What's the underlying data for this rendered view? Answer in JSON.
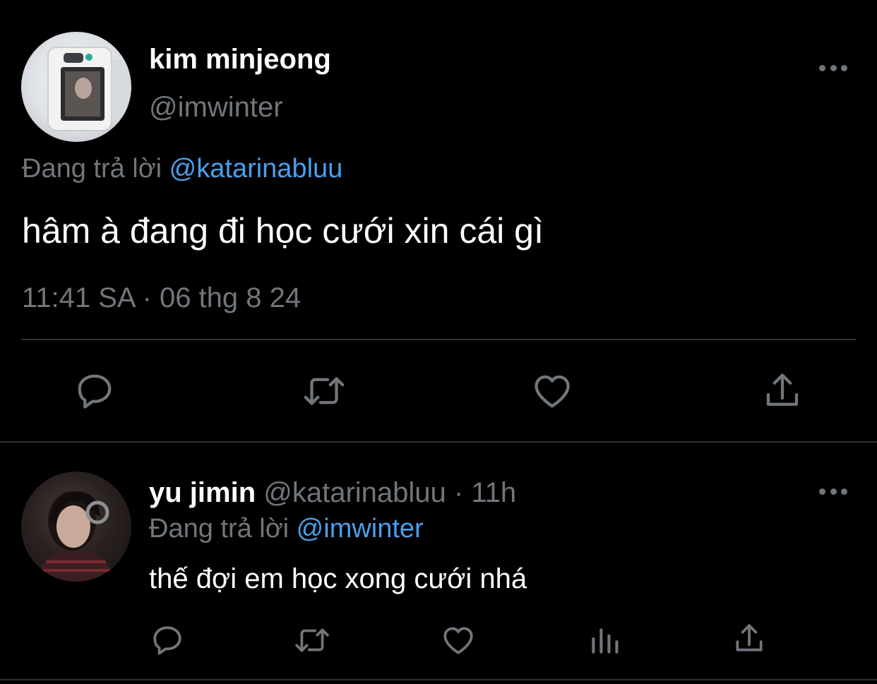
{
  "main_tweet": {
    "display_name": "kim minjeong",
    "handle": "@imwinter",
    "replying_label": "Đang trả lời",
    "replying_to": "@katarinabluu",
    "text": "hâm à đang đi học cưới xin cái gì",
    "timestamp": "11:41 SA · 06 thg 8 24",
    "actions": [
      "reply-icon",
      "retweet-icon",
      "like-icon",
      "share-icon"
    ]
  },
  "reply_tweet": {
    "display_name": "yu jimin",
    "handle": "@katarinabluu",
    "separator": " · ",
    "age": "11h",
    "replying_label": "Đang trả lời",
    "replying_to": "@imwinter",
    "text": "thế đợi em học xong cưới nhá",
    "actions": [
      "reply-icon",
      "retweet-icon",
      "like-icon",
      "views-icon",
      "share-icon"
    ]
  },
  "colors": {
    "background": "#000000",
    "text_primary": "#ffffff",
    "text_muted": "#71767b",
    "link": "#4a9fec",
    "divider": "#2f3336"
  }
}
